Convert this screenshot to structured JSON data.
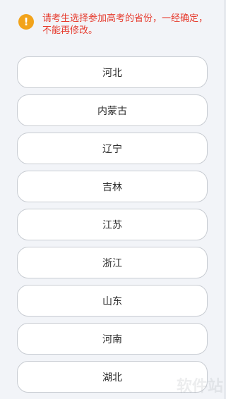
{
  "notice": {
    "icon": "exclamation-icon",
    "text": "请考生选择参加高考的省份，一经确定，\n不能再修改。"
  },
  "provinces": [
    "河北",
    "内蒙古",
    "辽宁",
    "吉林",
    "江苏",
    "浙江",
    "山东",
    "河南",
    "湖北"
  ],
  "colors": {
    "notice_text": "#e63b2e",
    "notice_icon": "#f2a31b",
    "background": "#f2f4f8",
    "button_bg": "#ffffff",
    "button_border": "#c8ccd2"
  },
  "watermark": "软件站"
}
